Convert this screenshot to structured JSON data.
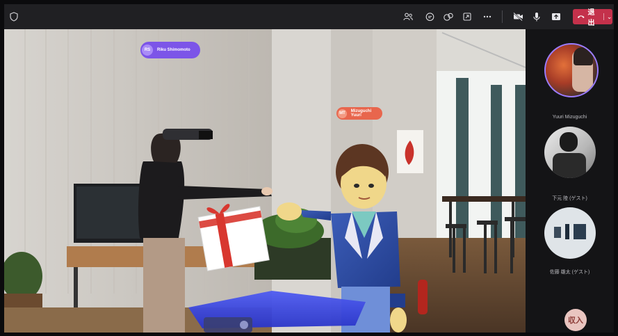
{
  "toolbar": {
    "leave_label": "退出",
    "icons": [
      "people-icon",
      "chat-icon",
      "reactions-icon",
      "share-tray-icon",
      "more-icon",
      "camera-off-icon",
      "mic-icon",
      "share-screen-icon"
    ]
  },
  "scene": {
    "tags": [
      {
        "initials": "RS",
        "name": "Riku Shimomoto",
        "color": "#8b5cf6"
      },
      {
        "initials": "MT",
        "name": "Mizuguchi Yuuri",
        "color": "#e8664d"
      }
    ]
  },
  "participants": [
    {
      "name": "Yuuri Mizuguchi"
    },
    {
      "name": "下元 陸 (ゲスト)"
    },
    {
      "name": "佐藤 雄太 (ゲスト)"
    }
  ],
  "badge": {
    "text": "収入"
  }
}
